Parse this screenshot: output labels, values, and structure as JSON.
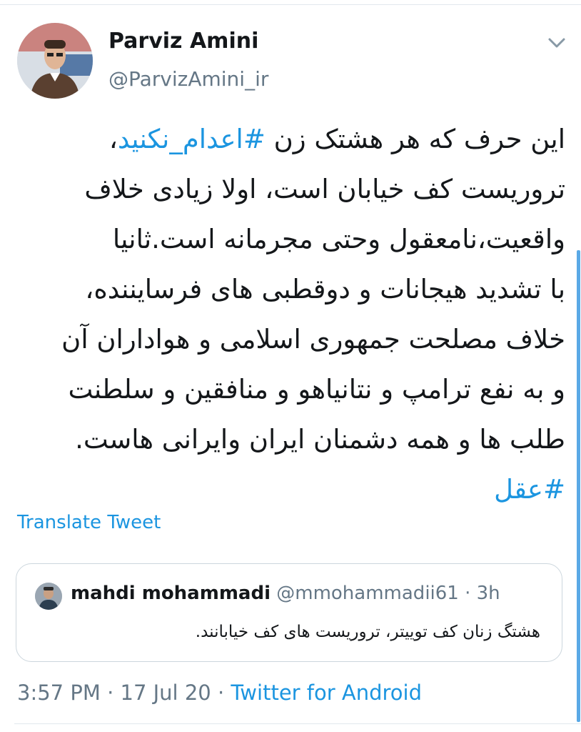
{
  "tweet": {
    "author_name": "Parviz Amini",
    "author_handle": "@ParvizAmini_ir",
    "menu_icon": "chevron-down-icon",
    "body": {
      "line1_prefix": "این حرف که هر هشتک زن ",
      "hashtag1": "#اعدام_نکنید",
      "line1_suffix": "،",
      "line2": "تروریست کف خیابان است، اولا زیادی خلاف",
      "line3": "واقعیت،نامعقول وحتی مجرمانه است.ثانیا",
      "line4": "با تشدید هیجانات و دوقطبی های فرسایننده،",
      "line5": "خلاف مصلحت جمهوری اسلامی و هواداران آن",
      "line6": "و به نفع ترامپ و نتانیاهو و منافقین و سلطنت",
      "line7": "طلب ها و همه دشمنان ایران وایرانی هاست.",
      "hashtag2": "#عقل"
    },
    "translate_label": "Translate Tweet",
    "timestamp": "3:57 PM · 17 Jul 20 · ",
    "source": "Twitter for Android"
  },
  "quote": {
    "name": "mahdi mohammadi",
    "handle_time": " @mmohammadii61 · 3h",
    "text": "هشتگ زنان کف توییتر، تروریست های کف خیابانند."
  },
  "colors": {
    "link": "#1b95e0",
    "secondary_text": "#657786",
    "border": "#ccd6dd"
  }
}
